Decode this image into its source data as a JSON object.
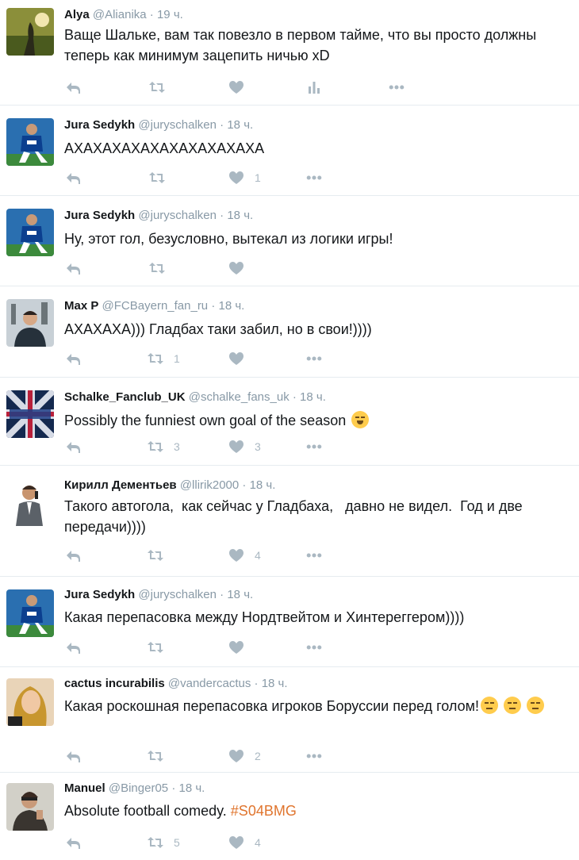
{
  "tweets": [
    {
      "name": "Alya",
      "handle": "@Alianika",
      "time": "19 ч.",
      "text": "Ваще Шальке, вам так повезло в первом тайме, что вы просто должны теперь как минимум зацепить ничью xD",
      "retweets": "",
      "likes": ""
    },
    {
      "name": "Jura Sedykh",
      "handle": "@juryschalken",
      "time": "18 ч.",
      "text": "АХАХАХАХАХАХАХАХАХАХА",
      "retweets": "",
      "likes": "1"
    },
    {
      "name": "Jura Sedykh",
      "handle": "@juryschalken",
      "time": "18 ч.",
      "text": "Ну, этот гол, безусловно, вытекал из логики игры!",
      "retweets": "",
      "likes": ""
    },
    {
      "name": "Max P",
      "handle": "@FCBayern_fan_ru",
      "time": "18 ч.",
      "text": "АХАХАХА))) Гладбах таки забил, но в свои!))))",
      "retweets": "1",
      "likes": ""
    },
    {
      "name": "Schalke_Fanclub_UK",
      "handle": "@schalke_fans_uk",
      "time": "18 ч.",
      "text": "Possibly the funniest own goal of the season",
      "retweets": "3",
      "likes": "3"
    },
    {
      "name": "Кирилл Дементьев",
      "handle": "@llirik2000",
      "time": "18 ч.",
      "text": "Такого автогола,  как сейчас у Гладбаха,   давно не видел.  Год и две передачи))))",
      "retweets": "",
      "likes": "4"
    },
    {
      "name": "Jura Sedykh",
      "handle": "@juryschalken",
      "time": "18 ч.",
      "text": "Какая перепасовка между Нордтвейтом и Хинтереггером))))",
      "retweets": "",
      "likes": ""
    },
    {
      "name": "cactus incurabilis",
      "handle": "@vandercactus",
      "time": "18 ч.",
      "text": "Какая роскошная перепасовка игроков Боруссии перед голом!",
      "retweets": "",
      "likes": "2"
    },
    {
      "name": "Manuel",
      "handle": "@Binger05",
      "time": "18 ч.",
      "text": "Absolute football comedy. ",
      "hashtag": "#S04BMG",
      "retweets": "5",
      "likes": "4"
    }
  ],
  "dot": "·",
  "colors": {
    "icon": "#aab8c2",
    "hashtag": "#e0752e",
    "muted": "#8899a6"
  }
}
